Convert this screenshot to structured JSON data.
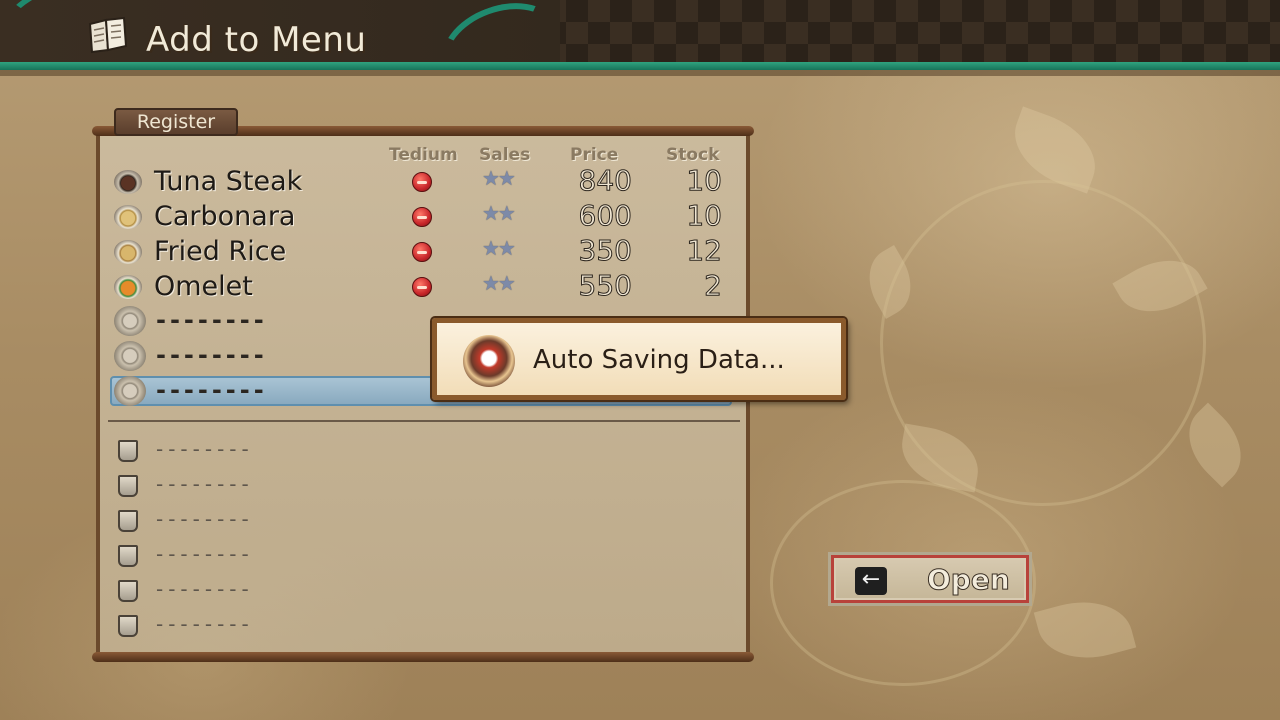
{
  "header": {
    "title": "Add to Menu",
    "icon": "recipe-book-icon"
  },
  "panel": {
    "tab_label": "Register",
    "columns": {
      "tedium": "Tedium",
      "sales": "Sales",
      "price": "Price",
      "stock": "Stock"
    },
    "items": [
      {
        "name": "Tuna Steak",
        "icon": "tuna-steak-dish-icon",
        "tedium_icon": "tedium-face-icon",
        "sales": "★★",
        "price": "840",
        "stock": "10"
      },
      {
        "name": "Carbonara",
        "icon": "carbonara-dish-icon",
        "tedium_icon": "tedium-face-icon",
        "sales": "★★",
        "price": "600",
        "stock": "10"
      },
      {
        "name": "Fried Rice",
        "icon": "fried-rice-dish-icon",
        "tedium_icon": "tedium-face-icon",
        "sales": "★★",
        "price": "350",
        "stock": "12"
      },
      {
        "name": "Omelet",
        "icon": "omelet-dish-icon",
        "tedium_icon": "tedium-face-icon",
        "sales": "★★",
        "price": "550",
        "stock": "2"
      }
    ],
    "empty_food_slots": [
      "--------",
      "--------",
      "--------"
    ],
    "empty_drink_slots": [
      "--------",
      "--------",
      "--------",
      "--------",
      "--------",
      "--------"
    ]
  },
  "popup": {
    "text": "Auto Saving Data...",
    "icon": "autosave-character-icon"
  },
  "open_button": {
    "key": "←",
    "label": "Open"
  },
  "colors": {
    "accent_green": "#1f8a6e",
    "selection_blue": "#89aabf",
    "wood_brown": "#6b4a2c"
  }
}
